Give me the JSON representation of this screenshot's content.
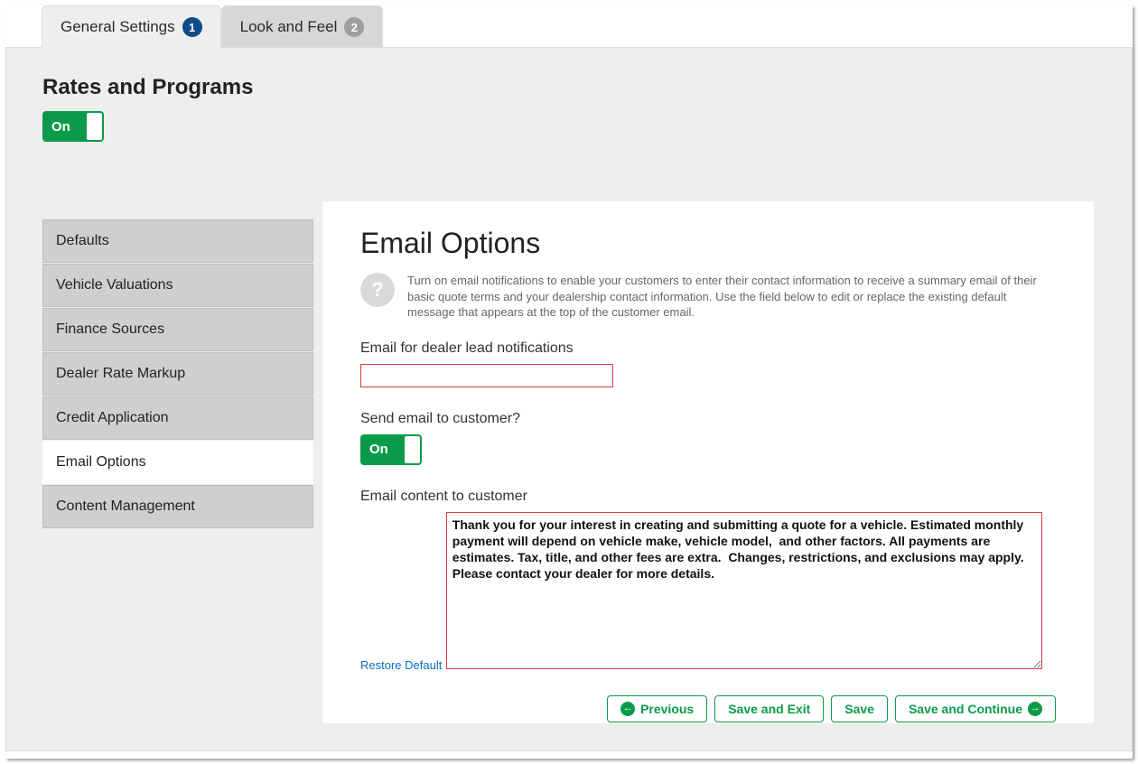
{
  "tabs": {
    "general": {
      "label": "General Settings",
      "badge": "1"
    },
    "look": {
      "label": "Look and Feel",
      "badge": "2"
    }
  },
  "section": {
    "title": "Rates and Programs",
    "toggle": "On"
  },
  "sidebar": {
    "items": [
      {
        "label": "Defaults"
      },
      {
        "label": "Vehicle Valuations"
      },
      {
        "label": "Finance Sources"
      },
      {
        "label": "Dealer Rate Markup"
      },
      {
        "label": "Credit Application"
      },
      {
        "label": "Email Options"
      },
      {
        "label": "Content Management"
      }
    ],
    "activeIndex": 5
  },
  "main": {
    "title": "Email Options",
    "help": "Turn on email notifications to enable your customers to enter their contact information to receive a summary email of their basic quote terms and your dealership contact information. Use the field below to edit or replace the existing default message that appears at the top of the customer email.",
    "dealerEmailLabel": "Email for dealer lead notifications",
    "dealerEmailValue": "",
    "sendLabel": "Send email to customer?",
    "sendToggle": "On",
    "contentLabel": "Email content to customer",
    "restore": "Restore Default",
    "body": "Thank you for your interest in creating and submitting a quote for a vehicle. Estimated monthly payment will depend on vehicle make, vehicle model,  and other factors. All payments are estimates. Tax, title, and other fees are extra.  Changes, restrictions, and exclusions may apply. Please contact your dealer for more details."
  },
  "buttons": {
    "previous": "Previous",
    "saveExit": "Save and Exit",
    "save": "Save",
    "saveContinue": "Save and Continue"
  },
  "glyphs": {
    "help": "?",
    "left": "←",
    "right": "→"
  }
}
